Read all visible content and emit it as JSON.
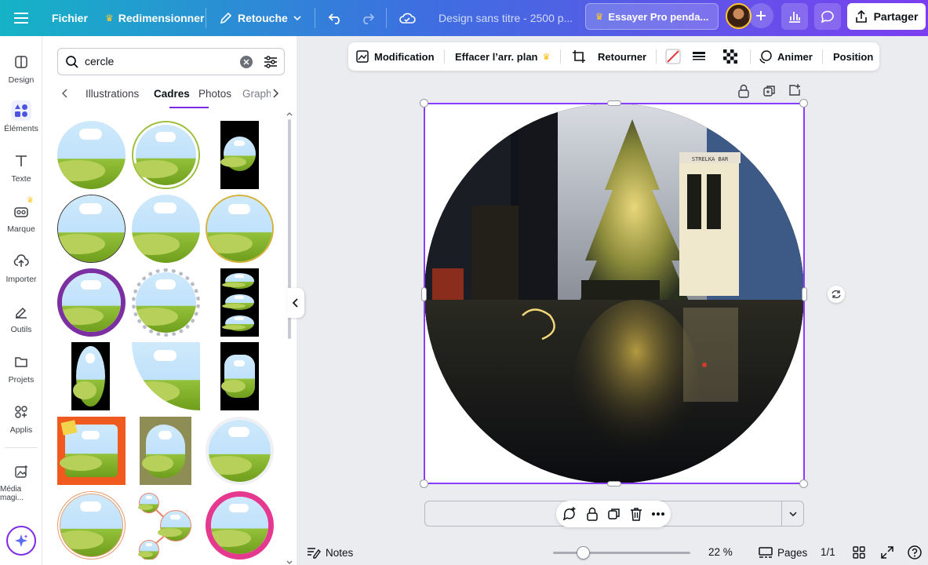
{
  "topbar": {
    "menu_icon": "hamburger-icon",
    "file_label": "Fichier",
    "resize_label": "Redimensionner",
    "retouch_label": "Retouche",
    "doc_title": "Design sans titre - 2500 p...",
    "pro_label": "Essayer Pro penda...",
    "share_label": "Partager"
  },
  "rail": {
    "items": [
      {
        "label": "Design",
        "icon": "layout-icon"
      },
      {
        "label": "Éléments",
        "icon": "shapes-icon"
      },
      {
        "label": "Texte",
        "icon": "text-icon"
      },
      {
        "label": "Marque",
        "icon": "brand-icon"
      },
      {
        "label": "Importer",
        "icon": "upload-cloud-icon"
      },
      {
        "label": "Outils",
        "icon": "pen-icon"
      },
      {
        "label": "Projets",
        "icon": "folder-icon"
      },
      {
        "label": "Applis",
        "icon": "apps-icon"
      },
      {
        "label": "Média magi...",
        "icon": "magic-media-icon"
      }
    ]
  },
  "panel": {
    "search_value": "cercle",
    "tabs": [
      "Illustrations",
      "Cadres",
      "Photos",
      "Graph"
    ],
    "active_tab": "Cadres"
  },
  "context_toolbar": {
    "edit_label": "Modification",
    "bg_remove_label": "Effacer l’arr. plan",
    "flip_label": "Retourner",
    "animate_label": "Animer",
    "position_label": "Position"
  },
  "canvas": {
    "photo_sign": "STRELKA BAR"
  },
  "bottom": {
    "notes_label": "Notes",
    "zoom": "22 %",
    "pages_label": "Pages",
    "page_count": "1/1"
  },
  "colors": {
    "accent": "#8b3dff",
    "pro_crown": "#ffc72c"
  }
}
